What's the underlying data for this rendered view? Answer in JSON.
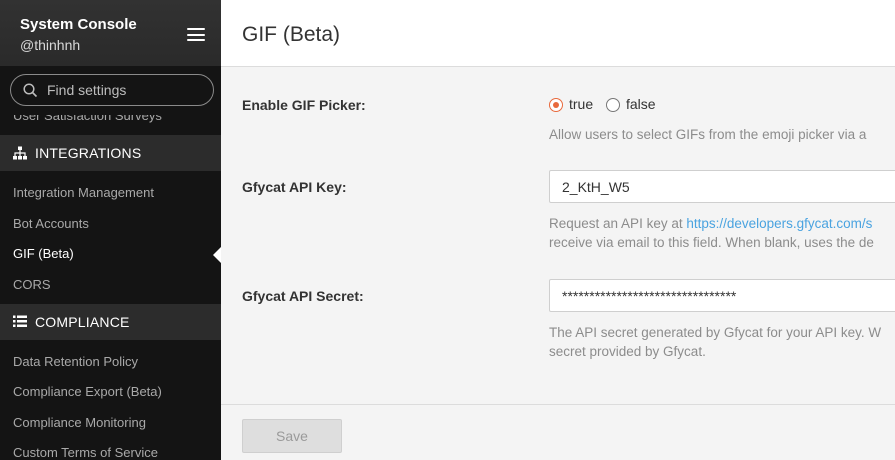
{
  "sidebar": {
    "title": "System Console",
    "user": "@thinhnh",
    "search_placeholder": "Find settings",
    "partial_item": "User Satisfaction Surveys",
    "sections": [
      {
        "label": "INTEGRATIONS",
        "icon": "sitemap-icon",
        "items": [
          "Integration Management",
          "Bot Accounts",
          "GIF (Beta)",
          "CORS"
        ]
      },
      {
        "label": "COMPLIANCE",
        "icon": "list-icon",
        "items": [
          "Data Retention Policy",
          "Compliance Export (Beta)",
          "Compliance Monitoring",
          "Custom Terms of Service"
        ]
      }
    ],
    "active_item": "GIF (Beta)"
  },
  "page": {
    "title": "GIF (Beta)",
    "settings": {
      "gif_picker": {
        "label": "Enable GIF Picker:",
        "true_label": "true",
        "false_label": "false",
        "selected": "true",
        "help": "Allow users to select GIFs from the emoji picker via a"
      },
      "api_key": {
        "label": "Gfycat API Key:",
        "value": "2_KtH_W5",
        "help_prefix": "Request an API key at ",
        "help_link": "https://developers.gfycat.com/s",
        "help_line2": "receive via email to this field. When blank, uses the de"
      },
      "api_secret": {
        "label": "Gfycat API Secret:",
        "value": "********************************",
        "help_line1": "The API secret generated by Gfycat for your API key. W",
        "help_line2": "secret provided by Gfycat."
      }
    },
    "save_label": "Save"
  },
  "colors": {
    "sidebar_bg": "#141414",
    "section_bg": "#2c2c2c",
    "radio_accent": "#e8693c",
    "link": "#4aa3e0"
  }
}
